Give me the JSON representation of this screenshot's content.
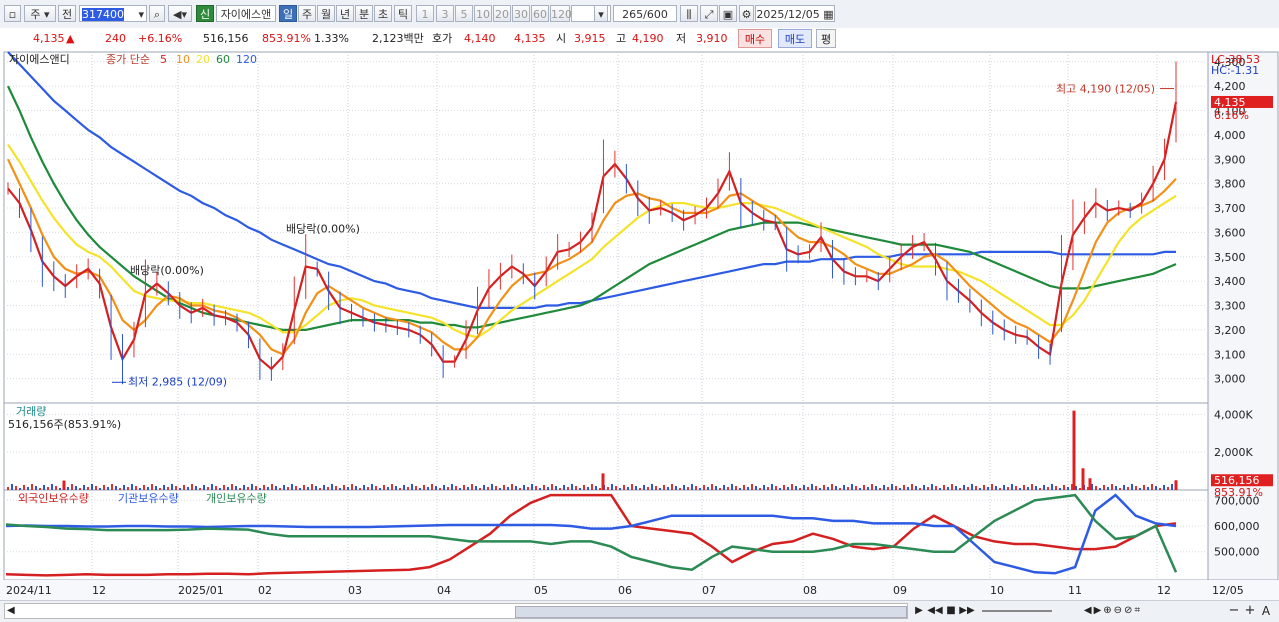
{
  "toolbar": {
    "market": "주",
    "prev": "전",
    "code": "317400",
    "new_tag": "신",
    "name": "자이에스앤",
    "periods": [
      "일",
      "주",
      "월",
      "년",
      "분",
      "초",
      "틱"
    ],
    "active_period": "일",
    "minutes": [
      "1",
      "3",
      "5",
      "10",
      "20",
      "30",
      "60",
      "120"
    ],
    "count": "265",
    "max_count": "/600",
    "date": "2025/12/05"
  },
  "infobar": {
    "price": "4,135",
    "arrow": "▲",
    "change": "240",
    "change_pct": "+6.16%",
    "volume": "516,156",
    "volume_pct": "853.91%",
    "turnover": "1.33%",
    "amount": "2,123백만",
    "quote_label": "호가",
    "ask": "4,140",
    "bid": "4,135",
    "open_label": "시",
    "open": "3,915",
    "high_label": "고",
    "high": "4,190",
    "low_label": "저",
    "low": "3,910",
    "buy": "매수",
    "sell": "매도",
    "eval": "평"
  },
  "chart_data": [
    {
      "type": "line",
      "panel": "price",
      "title": "자이에스앤디",
      "legend_label": "종가 단순",
      "y_ticks": [
        3000,
        3100,
        3200,
        3300,
        3400,
        3500,
        3600,
        3700,
        3800,
        3900,
        4000,
        4100,
        4200,
        4300
      ],
      "ylim": [
        2900,
        4340
      ],
      "x_ticks": [
        "2024/11",
        "12",
        "2025/01",
        "02",
        "03",
        "04",
        "05",
        "06",
        "07",
        "08",
        "09",
        "10",
        "11",
        "12",
        "12/05"
      ],
      "corner_labels": [
        "LC:38.53",
        "HC:-1.31"
      ],
      "last_price_label": "4,135",
      "last_pct_label": "6.16%",
      "annotations": [
        "최고 4,190 (12/05)",
        "최저 2,985 (12/09)",
        "배당락(0.00%)",
        "배당락(0.00%)"
      ],
      "series": [
        {
          "name": "5",
          "color": "#d42020",
          "values": [
            3780,
            3720,
            3610,
            3480,
            3420,
            3380,
            3420,
            3450,
            3390,
            3210,
            3080,
            3160,
            3350,
            3390,
            3350,
            3300,
            3270,
            3290,
            3260,
            3250,
            3230,
            3180,
            3080,
            3040,
            3090,
            3280,
            3460,
            3450,
            3360,
            3290,
            3270,
            3250,
            3230,
            3220,
            3210,
            3200,
            3180,
            3140,
            3070,
            3070,
            3160,
            3280,
            3370,
            3420,
            3460,
            3430,
            3380,
            3440,
            3520,
            3530,
            3560,
            3620,
            3830,
            3880,
            3820,
            3740,
            3690,
            3700,
            3680,
            3650,
            3670,
            3700,
            3760,
            3850,
            3720,
            3680,
            3650,
            3640,
            3530,
            3510,
            3520,
            3580,
            3490,
            3440,
            3420,
            3420,
            3400,
            3450,
            3500,
            3540,
            3560,
            3490,
            3400,
            3360,
            3320,
            3270,
            3230,
            3200,
            3180,
            3170,
            3130,
            3100,
            3390,
            3590,
            3660,
            3720,
            3690,
            3700,
            3690,
            3720,
            3800,
            3900,
            4135
          ]
        },
        {
          "name": "10",
          "color": "#f29018",
          "values": [
            3900,
            3800,
            3700,
            3590,
            3500,
            3450,
            3430,
            3440,
            3420,
            3340,
            3240,
            3200,
            3240,
            3300,
            3340,
            3330,
            3300,
            3300,
            3280,
            3270,
            3250,
            3220,
            3180,
            3120,
            3100,
            3160,
            3270,
            3350,
            3380,
            3350,
            3320,
            3290,
            3270,
            3250,
            3240,
            3230,
            3210,
            3190,
            3150,
            3120,
            3120,
            3170,
            3250,
            3320,
            3380,
            3420,
            3430,
            3440,
            3470,
            3490,
            3520,
            3560,
            3650,
            3720,
            3750,
            3760,
            3740,
            3730,
            3700,
            3680,
            3680,
            3680,
            3700,
            3750,
            3760,
            3730,
            3700,
            3670,
            3620,
            3580,
            3560,
            3560,
            3540,
            3510,
            3470,
            3450,
            3430,
            3430,
            3450,
            3470,
            3500,
            3510,
            3480,
            3430,
            3380,
            3340,
            3300,
            3260,
            3230,
            3210,
            3180,
            3150,
            3210,
            3320,
            3440,
            3560,
            3640,
            3680,
            3700,
            3710,
            3730,
            3770,
            3820
          ]
        },
        {
          "name": "20",
          "color": "#f4e32a",
          "values": [
            3960,
            3890,
            3810,
            3730,
            3660,
            3600,
            3550,
            3520,
            3500,
            3460,
            3410,
            3360,
            3340,
            3330,
            3320,
            3320,
            3310,
            3310,
            3300,
            3290,
            3280,
            3270,
            3250,
            3220,
            3190,
            3190,
            3220,
            3260,
            3300,
            3320,
            3330,
            3320,
            3300,
            3290,
            3280,
            3270,
            3260,
            3250,
            3230,
            3200,
            3180,
            3170,
            3200,
            3240,
            3280,
            3310,
            3340,
            3370,
            3400,
            3430,
            3460,
            3490,
            3540,
            3580,
            3620,
            3660,
            3690,
            3710,
            3720,
            3720,
            3710,
            3700,
            3700,
            3710,
            3720,
            3720,
            3710,
            3700,
            3680,
            3660,
            3640,
            3620,
            3600,
            3580,
            3560,
            3540,
            3510,
            3490,
            3470,
            3460,
            3460,
            3460,
            3450,
            3440,
            3420,
            3400,
            3370,
            3340,
            3310,
            3280,
            3250,
            3220,
            3220,
            3260,
            3320,
            3400,
            3480,
            3560,
            3620,
            3660,
            3690,
            3720,
            3750
          ]
        },
        {
          "name": "60",
          "color": "#1e8a3a",
          "values": [
            4200,
            4100,
            3990,
            3890,
            3800,
            3720,
            3650,
            3590,
            3540,
            3500,
            3460,
            3420,
            3390,
            3360,
            3330,
            3310,
            3290,
            3270,
            3260,
            3250,
            3240,
            3230,
            3220,
            3210,
            3200,
            3200,
            3200,
            3210,
            3220,
            3230,
            3240,
            3240,
            3240,
            3240,
            3240,
            3240,
            3230,
            3230,
            3220,
            3220,
            3210,
            3210,
            3220,
            3230,
            3240,
            3250,
            3260,
            3270,
            3280,
            3290,
            3300,
            3320,
            3350,
            3380,
            3410,
            3440,
            3470,
            3490,
            3510,
            3530,
            3550,
            3570,
            3590,
            3610,
            3620,
            3630,
            3640,
            3640,
            3640,
            3640,
            3630,
            3620,
            3610,
            3600,
            3590,
            3580,
            3570,
            3560,
            3550,
            3550,
            3550,
            3550,
            3540,
            3530,
            3520,
            3500,
            3480,
            3460,
            3440,
            3420,
            3400,
            3380,
            3370,
            3370,
            3370,
            3380,
            3390,
            3400,
            3410,
            3420,
            3430,
            3450,
            3470
          ]
        },
        {
          "name": "120",
          "color": "#2d5be3",
          "values": [
            4340,
            4290,
            4240,
            4190,
            4140,
            4100,
            4060,
            4020,
            3990,
            3950,
            3920,
            3890,
            3860,
            3830,
            3800,
            3770,
            3750,
            3720,
            3700,
            3670,
            3650,
            3620,
            3600,
            3570,
            3550,
            3530,
            3510,
            3490,
            3470,
            3460,
            3440,
            3420,
            3400,
            3390,
            3370,
            3360,
            3350,
            3330,
            3320,
            3310,
            3300,
            3290,
            3290,
            3290,
            3290,
            3290,
            3290,
            3300,
            3300,
            3310,
            3310,
            3320,
            3330,
            3340,
            3350,
            3360,
            3370,
            3380,
            3390,
            3400,
            3410,
            3420,
            3430,
            3440,
            3450,
            3460,
            3470,
            3470,
            3480,
            3480,
            3480,
            3490,
            3490,
            3490,
            3500,
            3500,
            3500,
            3500,
            3510,
            3510,
            3510,
            3510,
            3510,
            3510,
            3510,
            3520,
            3520,
            3520,
            3520,
            3520,
            3520,
            3520,
            3510,
            3510,
            3510,
            3510,
            3510,
            3510,
            3510,
            3510,
            3510,
            3520,
            3520
          ]
        }
      ]
    },
    {
      "type": "bar",
      "panel": "volume",
      "title": "거래량",
      "value_label": "516,156주(853.91%)",
      "y_ticks": [
        "2,000K",
        "4,000K"
      ],
      "y_tick_values": [
        2000,
        4000
      ],
      "ylim": [
        0,
        4600
      ],
      "last_value_label": "516,156",
      "last_pct_label": "853.91%",
      "spikes": [
        {
          "x": 64,
          "value": 500
        },
        {
          "x": 603,
          "value": 880
        },
        {
          "x": 1074,
          "value": 4200
        },
        {
          "x": 1083,
          "value": 1150
        },
        {
          "x": 1090,
          "value": 620
        },
        {
          "x": 1176,
          "value": 516
        }
      ]
    },
    {
      "type": "line",
      "panel": "holdings",
      "legend": [
        "외국인보유수량",
        "기관보유수량",
        "개인보유수량"
      ],
      "y_ticks": [
        "500,000",
        "600,000",
        "700,000"
      ],
      "y_tick_values": [
        500000,
        600000,
        700000
      ],
      "ylim": [
        390000,
        740000
      ],
      "series": [
        {
          "name": "외국인보유수량",
          "color": "#d42020",
          "values": [
            412000,
            410000,
            408000,
            410000,
            412000,
            410000,
            410000,
            410000,
            412000,
            412000,
            414000,
            414000,
            412000,
            416000,
            418000,
            420000,
            422000,
            424000,
            426000,
            428000,
            430000,
            440000,
            470000,
            520000,
            570000,
            640000,
            690000,
            720000,
            720000,
            720000,
            720000,
            600000,
            590000,
            580000,
            570000,
            520000,
            460000,
            500000,
            530000,
            540000,
            570000,
            550000,
            520000,
            510000,
            520000,
            590000,
            640000,
            600000,
            560000,
            540000,
            530000,
            530000,
            520000,
            510000,
            510000,
            520000,
            560000,
            600000,
            610000
          ]
        },
        {
          "name": "기관보유수량",
          "color": "#2d5be3",
          "values": [
            600000,
            602000,
            600000,
            600000,
            598000,
            598000,
            600000,
            600000,
            598000,
            598000,
            596000,
            598000,
            600000,
            600000,
            598000,
            596000,
            596000,
            596000,
            596000,
            598000,
            600000,
            602000,
            604000,
            604000,
            604000,
            604000,
            604000,
            604000,
            600000,
            590000,
            590000,
            600000,
            620000,
            640000,
            640000,
            640000,
            640000,
            640000,
            640000,
            630000,
            630000,
            620000,
            620000,
            610000,
            610000,
            610000,
            600000,
            600000,
            530000,
            460000,
            440000,
            420000,
            416000,
            440000,
            660000,
            720000,
            640000,
            610000,
            600000
          ]
        },
        {
          "name": "개인보유수량",
          "color": "#2c8a55",
          "values": [
            606000,
            600000,
            596000,
            590000,
            588000,
            584000,
            584000,
            584000,
            584000,
            586000,
            590000,
            588000,
            586000,
            570000,
            560000,
            560000,
            560000,
            560000,
            560000,
            560000,
            560000,
            560000,
            550000,
            540000,
            540000,
            540000,
            540000,
            530000,
            540000,
            540000,
            520000,
            480000,
            460000,
            440000,
            430000,
            480000,
            520000,
            510000,
            500000,
            500000,
            500000,
            510000,
            530000,
            530000,
            520000,
            510000,
            500000,
            500000,
            560000,
            620000,
            660000,
            700000,
            710000,
            720000,
            620000,
            550000,
            560000,
            600000,
            420000
          ]
        }
      ]
    }
  ],
  "bottom": {
    "icons": [
      "▶",
      "◀◀",
      "■",
      "▶▶"
    ],
    "zoom": [
      "−",
      "+",
      "A"
    ]
  }
}
